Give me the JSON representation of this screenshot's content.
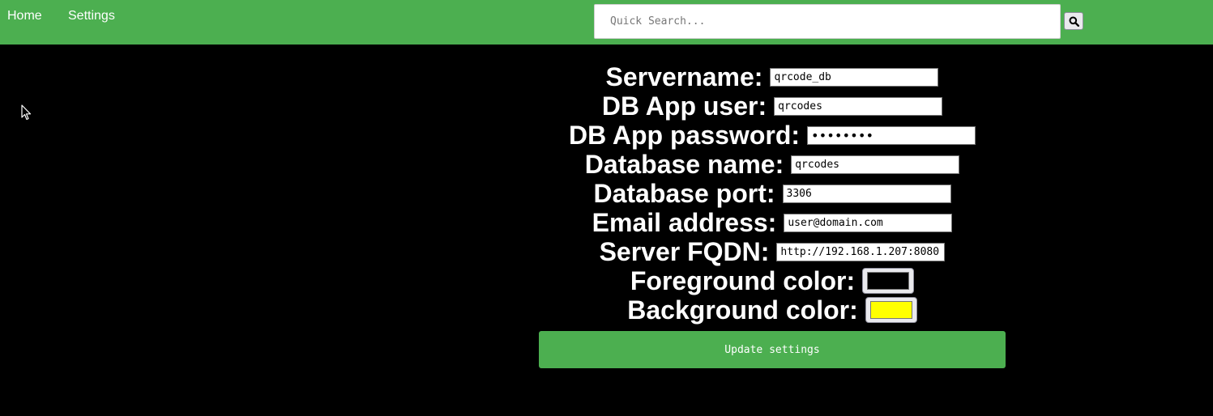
{
  "nav": {
    "home_label": "Home",
    "settings_label": "Settings"
  },
  "search": {
    "placeholder": "Quick Search...",
    "icon": "search-icon"
  },
  "form": {
    "servername": {
      "label": "Servername:",
      "value": "qrcode_db"
    },
    "db_app_user": {
      "label": "DB App user:",
      "value": "qrcodes"
    },
    "db_app_password": {
      "label": "DB App password:",
      "value": "••••••••"
    },
    "database_name": {
      "label": "Database name:",
      "value": "qrcodes"
    },
    "database_port": {
      "label": "Database port:",
      "value": "3306"
    },
    "email_address": {
      "label": "Email address:",
      "value": "user@domain.com"
    },
    "server_fqdn": {
      "label": "Server FQDN:",
      "value": "http://192.168.1.207:8080"
    },
    "foreground_color": {
      "label": "Foreground color:",
      "value": "#000000"
    },
    "background_color": {
      "label": "Background color:",
      "value": "#ffff00"
    },
    "submit_label": "Update settings"
  },
  "colors": {
    "accent": "#4caf50",
    "page_background": "#000000",
    "label_text": "#ffffff"
  }
}
